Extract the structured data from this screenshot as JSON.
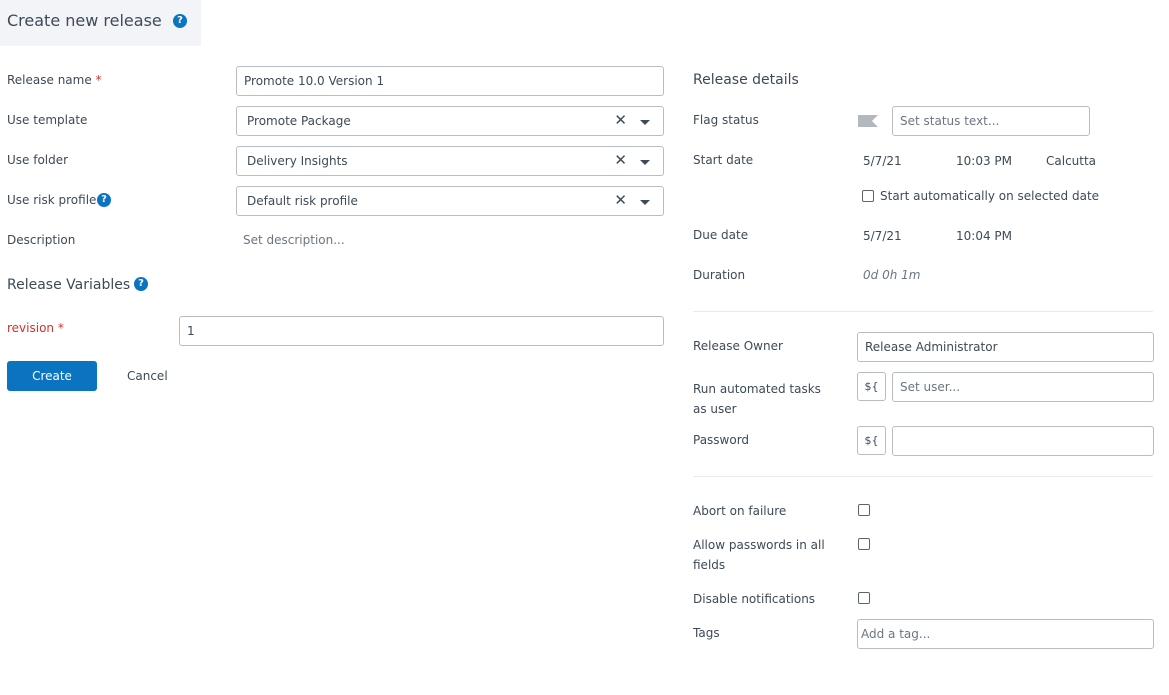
{
  "header": {
    "title": "Create new release",
    "help_icon": "?"
  },
  "left": {
    "fields": [
      {
        "label": "Release name",
        "required": true,
        "value": "Promote 10.0 Version 1"
      },
      {
        "label": "Use template",
        "value": "Promote Package",
        "clear_icon": "✕"
      },
      {
        "label": "Use folder",
        "value": "Delivery Insights",
        "clear_icon": "✕"
      },
      {
        "label": "Use risk profile",
        "value": "Default risk profile",
        "clear_icon": "✕",
        "help": true
      },
      {
        "label": "Description",
        "placeholder": "Set description..."
      }
    ],
    "variables": {
      "title": "Release Variables",
      "items": [
        {
          "label": "revision",
          "required": true,
          "value": "1"
        }
      ]
    },
    "required_mark": "*",
    "create_label": "Create",
    "cancel_label": "Cancel"
  },
  "right": {
    "title": "Release details",
    "flag_status": {
      "label": "Flag status",
      "placeholder": "Set status text..."
    },
    "start_date": {
      "label": "Start date",
      "date": "5/7/21",
      "time": "10:03 PM",
      "timezone": "Calcutta",
      "auto_start_label": "Start automatically on selected date",
      "auto_start_checked": false
    },
    "due_date": {
      "label": "Due date",
      "date": "5/7/21",
      "time": "10:04 PM"
    },
    "duration": {
      "label": "Duration",
      "value": "0d 0h 1m"
    },
    "owner": {
      "label": "Release Owner",
      "value": "Release Administrator"
    },
    "run_as": {
      "label_line1": "Run automated tasks",
      "label_line2": "as user",
      "placeholder": "Set user...",
      "var_button": "${"
    },
    "password": {
      "label": "Password",
      "value": "",
      "var_button": "${"
    },
    "abort_on_failure": {
      "label": "Abort on failure",
      "checked": false
    },
    "allow_passwords": {
      "label_line1": "Allow passwords in all",
      "label_line2": "fields",
      "checked": false
    },
    "disable_notifications": {
      "label": "Disable notifications",
      "checked": false
    },
    "tags": {
      "label": "Tags",
      "placeholder": "Add a tag..."
    }
  },
  "colors": {
    "primary": "#0a74c1",
    "required": "#d0312d",
    "header_bg": "#f3f4f8"
  }
}
